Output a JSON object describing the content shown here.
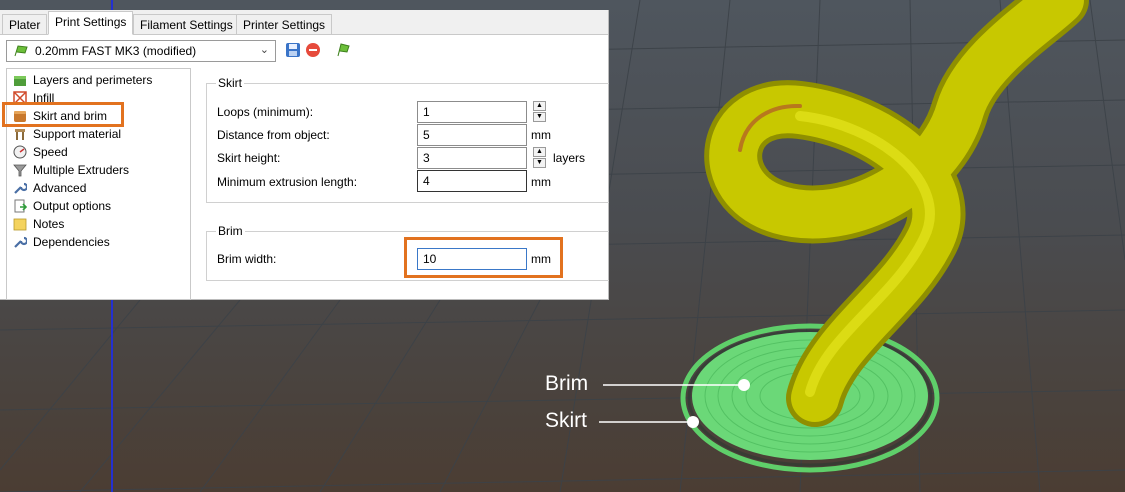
{
  "tabs": [
    "Plater",
    "Print Settings",
    "Filament Settings",
    "Printer Settings"
  ],
  "preset": {
    "value": "0.20mm FAST MK3 (modified)"
  },
  "sidebar": {
    "items": [
      {
        "label": "Layers and perimeters",
        "icon": "layers-icon"
      },
      {
        "label": "Infill",
        "icon": "infill-icon"
      },
      {
        "label": "Skirt and brim",
        "icon": "skirt-brim-icon"
      },
      {
        "label": "Support material",
        "icon": "support-icon"
      },
      {
        "label": "Speed",
        "icon": "speed-icon"
      },
      {
        "label": "Multiple Extruders",
        "icon": "funnel-icon"
      },
      {
        "label": "Advanced",
        "icon": "wrench-icon"
      },
      {
        "label": "Output options",
        "icon": "output-icon"
      },
      {
        "label": "Notes",
        "icon": "note-icon"
      },
      {
        "label": "Dependencies",
        "icon": "wrench-icon"
      }
    ]
  },
  "skirt": {
    "title": "Skirt",
    "loops_label": "Loops (minimum):",
    "loops_value": "1",
    "distance_label": "Distance from object:",
    "distance_value": "5",
    "distance_unit": "mm",
    "height_label": "Skirt height:",
    "height_value": "3",
    "height_unit": "layers",
    "minext_label": "Minimum extrusion length:",
    "minext_value": "4",
    "minext_unit": "mm"
  },
  "brim": {
    "title": "Brim",
    "width_label": "Brim width:",
    "width_value": "10",
    "width_unit": "mm"
  },
  "callouts": {
    "brim": "Brim",
    "skirt": "Skirt"
  },
  "colors": {
    "highlight": "#e2721f",
    "model": "#c8c800",
    "brim": "#5fcf6a"
  }
}
